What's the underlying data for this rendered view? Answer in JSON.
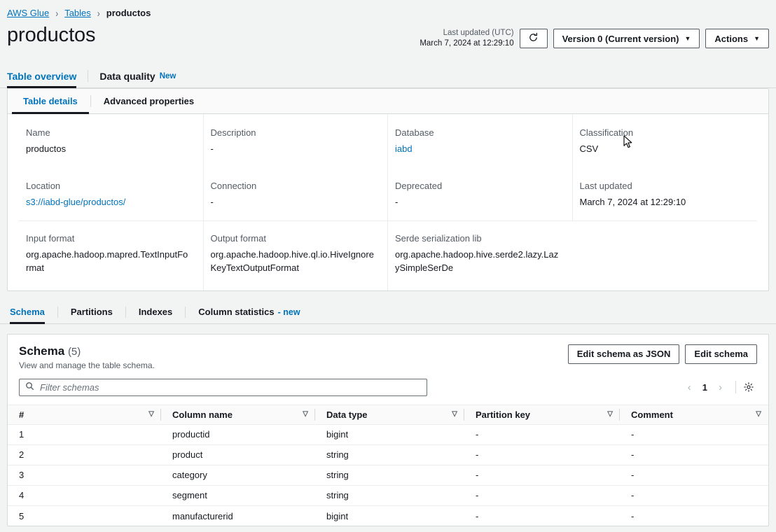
{
  "breadcrumb": {
    "items": [
      {
        "label": "AWS Glue",
        "link": true
      },
      {
        "label": "Tables",
        "link": true
      },
      {
        "label": "productos",
        "link": false
      }
    ],
    "separator": "›"
  },
  "header": {
    "title": "productos",
    "last_updated_label": "Last updated (UTC)",
    "last_updated_value": "March 7, 2024 at 12:29:10",
    "refresh_icon": "refresh-icon",
    "version_select": "Version 0 (Current version)",
    "actions_button": "Actions",
    "caret": "▼"
  },
  "top_tabs": [
    {
      "label": "Table overview",
      "active": true,
      "badge": ""
    },
    {
      "label": "Data quality",
      "active": false,
      "badge": "New"
    }
  ],
  "details_card": {
    "tabs": [
      {
        "label": "Table details",
        "active": true
      },
      {
        "label": "Advanced properties",
        "active": false
      }
    ],
    "fields_row1": [
      {
        "label": "Name",
        "value": "productos",
        "link": false
      },
      {
        "label": "Description",
        "value": "-",
        "link": false
      },
      {
        "label": "Database",
        "value": "iabd",
        "link": true
      },
      {
        "label": "Classification",
        "value": "CSV",
        "link": false
      }
    ],
    "fields_row2": [
      {
        "label": "Location",
        "value": "s3://iabd-glue/productos/",
        "link": true
      },
      {
        "label": "Connection",
        "value": "-",
        "link": false
      },
      {
        "label": "Deprecated",
        "value": "-",
        "link": false
      },
      {
        "label": "Last updated",
        "value": "March 7, 2024 at 12:29:10",
        "link": false
      }
    ],
    "fields_row3": [
      {
        "label": "Input format",
        "value": "org.apache.hadoop.mapred.TextInputFormat",
        "link": false
      },
      {
        "label": "Output format",
        "value": "org.apache.hadoop.hive.ql.io.HiveIgnoreKeyTextOutputFormat",
        "link": false
      },
      {
        "label": "Serde serialization lib",
        "value": "org.apache.hadoop.hive.serde2.lazy.LazySimpleSerDe",
        "link": false
      }
    ]
  },
  "schema_tabs": [
    {
      "label": "Schema",
      "active": true,
      "badge": ""
    },
    {
      "label": "Partitions",
      "active": false,
      "badge": ""
    },
    {
      "label": "Indexes",
      "active": false,
      "badge": ""
    },
    {
      "label": "Column statistics",
      "active": false,
      "badge": "- new"
    }
  ],
  "schema": {
    "title": "Schema",
    "count": "(5)",
    "subtitle": "View and manage the table schema.",
    "edit_json_button": "Edit schema as JSON",
    "edit_button": "Edit schema",
    "filter_placeholder": "Filter schemas",
    "search_icon": "search-icon",
    "gear_icon": "gear-icon",
    "prev_icon": "‹",
    "next_icon": "›",
    "page_number": "1",
    "columns": [
      "#",
      "Column name",
      "Data type",
      "Partition key",
      "Comment"
    ],
    "sort_icon": "▽",
    "rows": [
      {
        "num": "1",
        "name": "productid",
        "type": "bigint",
        "partition_key": "-",
        "comment": "-"
      },
      {
        "num": "2",
        "name": "product",
        "type": "string",
        "partition_key": "-",
        "comment": "-"
      },
      {
        "num": "3",
        "name": "category",
        "type": "string",
        "partition_key": "-",
        "comment": "-"
      },
      {
        "num": "4",
        "name": "segment",
        "type": "string",
        "partition_key": "-",
        "comment": "-"
      },
      {
        "num": "5",
        "name": "manufacturerid",
        "type": "bigint",
        "partition_key": "-",
        "comment": "-"
      }
    ]
  },
  "colors": {
    "link": "#0073bb",
    "page_bg": "#f2f3f3",
    "border": "#d5dbdb",
    "text": "#16191f",
    "muted": "#545b64"
  }
}
